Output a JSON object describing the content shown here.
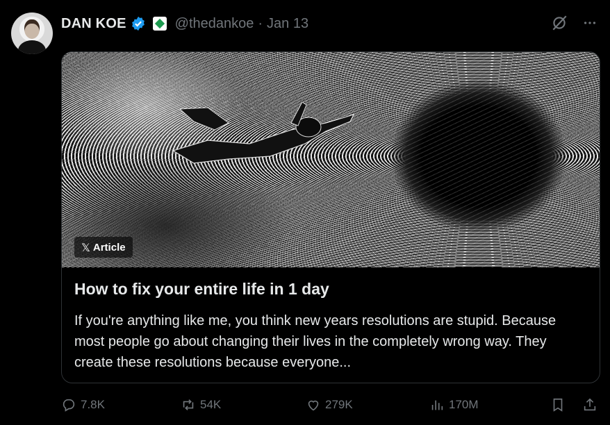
{
  "author": {
    "name": "DAN KOE",
    "handle": "@thedankoe",
    "separator": "·",
    "date": "Jan 13"
  },
  "article": {
    "badge": "Article",
    "title": "How to fix your entire life in 1 day",
    "excerpt": "If you're anything like me, you think new years resolutions are stupid. Because most people go about changing their lives in the completely wrong way. They create these resolutions because everyone..."
  },
  "actions": {
    "replies": "7.8K",
    "reposts": "54K",
    "likes": "279K",
    "views": "170M"
  },
  "colors": {
    "background": "#000000",
    "text_primary": "#e7e9ea",
    "text_secondary": "#71767b",
    "verified": "#1d9bf0",
    "border": "#2f3336"
  },
  "icons": [
    "verified-badge-icon",
    "affiliate-icon",
    "grok-icon",
    "more-icon",
    "x-logo-icon",
    "reply-icon",
    "repost-icon",
    "like-icon",
    "views-icon",
    "bookmark-icon",
    "share-icon"
  ]
}
